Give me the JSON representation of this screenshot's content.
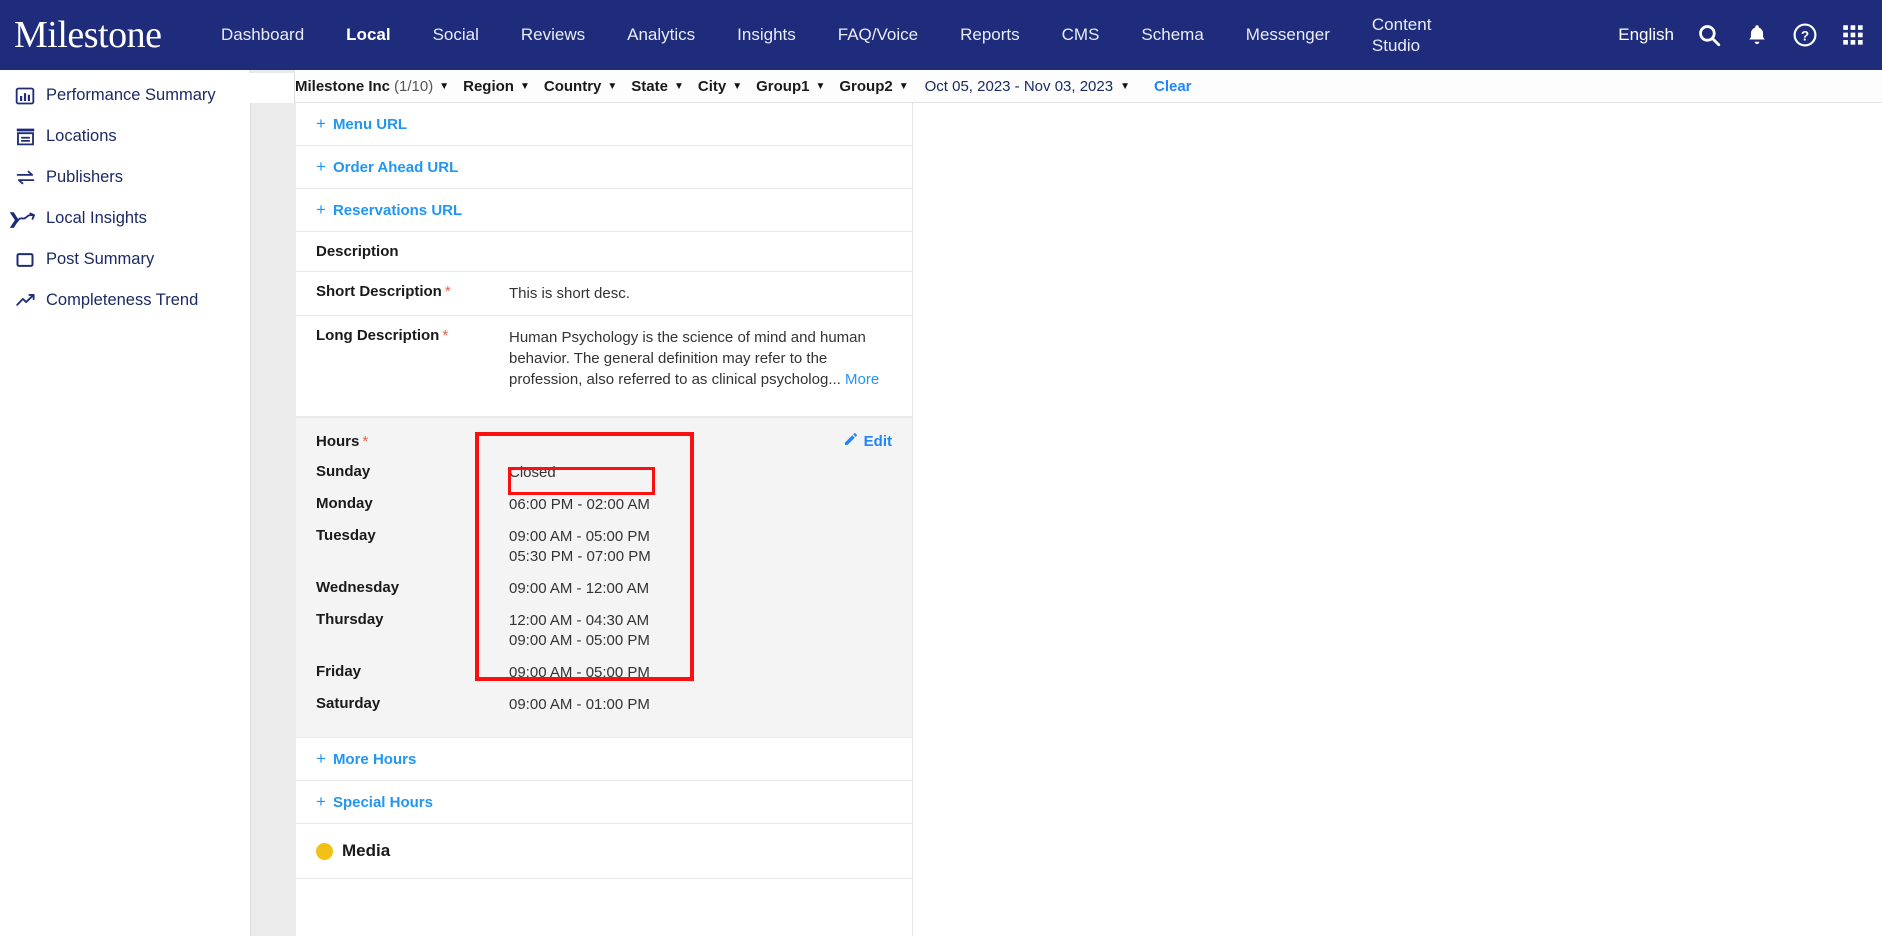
{
  "brand": {
    "logo_text": "Milestone",
    "header_bg": "#1f2c7c",
    "link_blue": "#2196f3",
    "accent_red": "#fb0f0f"
  },
  "topnav": {
    "items": [
      {
        "label": "Dashboard",
        "active": false
      },
      {
        "label": "Local",
        "active": true
      },
      {
        "label": "Social",
        "active": false
      },
      {
        "label": "Reviews",
        "active": false
      },
      {
        "label": "Analytics",
        "active": false
      },
      {
        "label": "Insights",
        "active": false
      },
      {
        "label": "FAQ/Voice",
        "active": false
      },
      {
        "label": "Reports",
        "active": false
      },
      {
        "label": "CMS",
        "active": false
      },
      {
        "label": "Schema",
        "active": false
      },
      {
        "label": "Messenger",
        "active": false
      }
    ],
    "content_studio_line1": "Content",
    "content_studio_line2": "Studio",
    "language": "English",
    "icons": [
      "search-icon",
      "bell-icon",
      "help-icon",
      "apps-grid-icon"
    ]
  },
  "sidebar": {
    "items": [
      {
        "label": "Performance Summary",
        "icon": "bar-chart-icon",
        "expandable": false
      },
      {
        "label": "Locations",
        "icon": "storefront-icon",
        "expandable": false
      },
      {
        "label": "Publishers",
        "icon": "exchange-arrows-icon",
        "expandable": false
      },
      {
        "label": "Local Insights",
        "icon": "trend-line-icon",
        "expandable": true
      },
      {
        "label": "Post Summary",
        "icon": "square-outline-icon",
        "expandable": false
      },
      {
        "label": "Completeness Trend",
        "icon": "trend-up-icon",
        "expandable": false
      }
    ]
  },
  "filterbar": {
    "collapse_icon": "chevron-left-icon",
    "account": "Milestone Inc",
    "account_count": "(1/10)",
    "filters": [
      "Region",
      "Country",
      "State",
      "City",
      "Group1",
      "Group2"
    ],
    "date_range": "Oct 05, 2023 - Nov 03, 2023",
    "clear_label": "Clear"
  },
  "main": {
    "links": [
      {
        "label": "Menu URL"
      },
      {
        "label": "Order Ahead URL"
      },
      {
        "label": "Reservations URL"
      }
    ],
    "description_section": {
      "title": "Description",
      "short_label": "Short Description",
      "short_value": "This is short desc.",
      "long_label": "Long Description",
      "long_value": "Human Psychology is the science of mind and human behavior. The general definition may refer to the profession, also referred to as clinical psycholog...",
      "more_label": "More"
    },
    "hours_section": {
      "title": "Hours",
      "edit_label": "Edit",
      "edit_icon": "pencil-icon",
      "rows": [
        {
          "day": "Sunday",
          "times": [
            "Closed"
          ]
        },
        {
          "day": "Monday",
          "times": [
            "06:00 PM - 02:00 AM"
          ]
        },
        {
          "day": "Tuesday",
          "times": [
            "09:00 AM - 05:00 PM",
            "05:30 PM - 07:00 PM"
          ]
        },
        {
          "day": "Wednesday",
          "times": [
            "09:00 AM - 12:00 AM"
          ]
        },
        {
          "day": "Thursday",
          "times": [
            "12:00 AM - 04:30 AM",
            "09:00 AM - 05:00 PM"
          ]
        },
        {
          "day": "Friday",
          "times": [
            "09:00 AM - 05:00 PM"
          ]
        },
        {
          "day": "Saturday",
          "times": [
            "09:00 AM - 01:00 PM"
          ]
        }
      ]
    },
    "bottom_links": [
      {
        "label": "More Hours"
      },
      {
        "label": "Special Hours"
      }
    ],
    "media_section": {
      "label": "Media",
      "status_icon": "yellow-status-dot"
    }
  }
}
